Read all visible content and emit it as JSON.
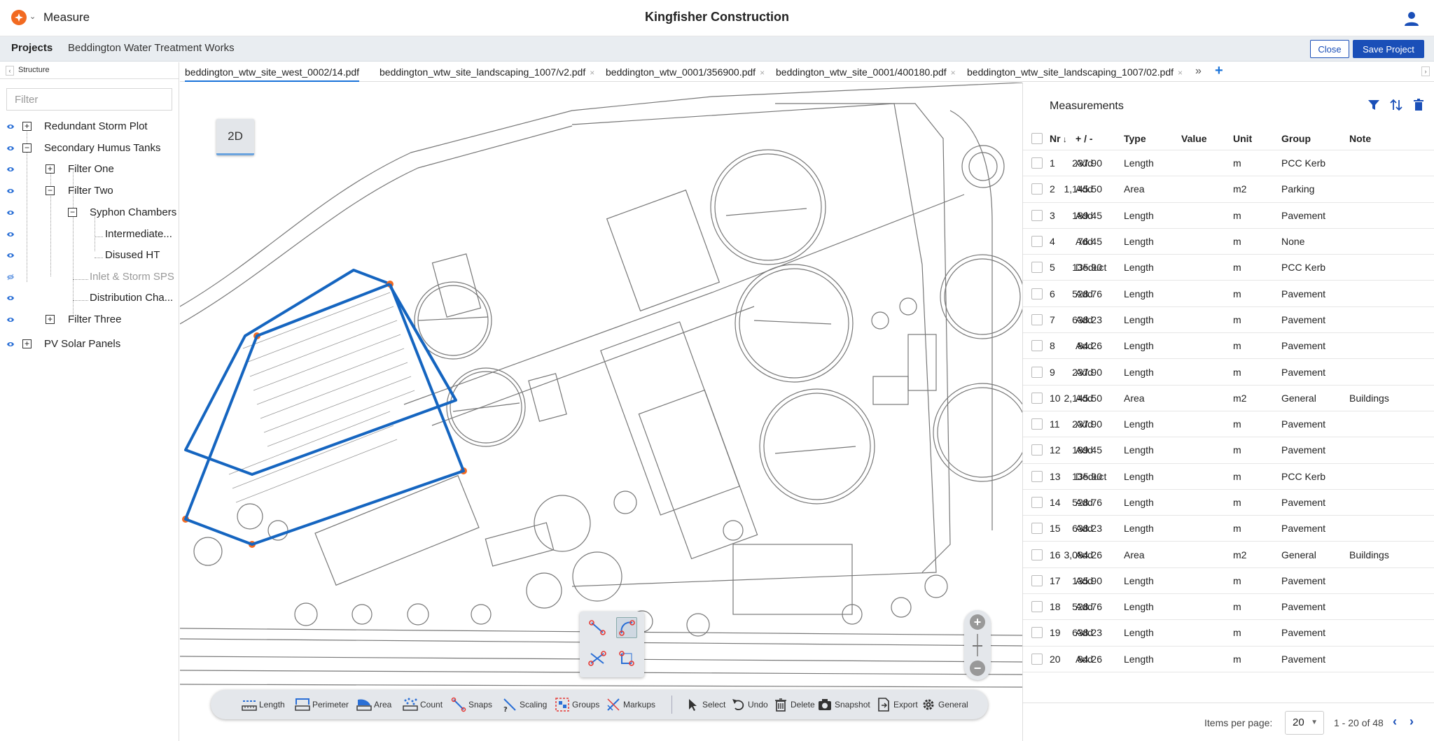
{
  "header": {
    "app_name": "Measure",
    "company": "Kingfisher Construction"
  },
  "projectbar": {
    "label": "Projects",
    "project_name": "Beddington Water Treatment Works",
    "close_label": "Close",
    "save_label": "Save Project"
  },
  "structure": {
    "title": "Structure",
    "filter_placeholder": "Filter",
    "items": [
      {
        "label": "Redundant Storm Plot",
        "level": 0,
        "toggle": "+"
      },
      {
        "label": "Secondary Humus Tanks",
        "level": 0,
        "toggle": "-"
      },
      {
        "label": "Filter One",
        "level": 1,
        "toggle": "+"
      },
      {
        "label": "Filter Two",
        "level": 1,
        "toggle": "-"
      },
      {
        "label": "Syphon Chambers",
        "level": 2,
        "toggle": "-"
      },
      {
        "label": "Intermediate...",
        "level": 3,
        "toggle": ""
      },
      {
        "label": "Disused HT",
        "level": 3,
        "toggle": ""
      },
      {
        "label": "Inlet & Storm SPS",
        "level": 2,
        "toggle": "",
        "hidden": true
      },
      {
        "label": "Distribution Cha...",
        "level": 2,
        "toggle": ""
      },
      {
        "label": "Filter Three",
        "level": 1,
        "toggle": "+"
      },
      {
        "label": "PV Solar Panels",
        "level": 0,
        "toggle": "+"
      }
    ]
  },
  "tabs": [
    {
      "label": "beddington_wtw_site_west_0002/14.pdf",
      "active": true
    },
    {
      "label": "beddington_wtw_site_landscaping_1007/v2.pdf"
    },
    {
      "label": "beddington_wtw_0001/356900.pdf"
    },
    {
      "label": "beddington_wtw_site_0001/400180.pdf"
    },
    {
      "label": "beddington_wtw_site_landscaping_1007/02.pdf"
    }
  ],
  "tabs_more": "»",
  "tabs_add": "+",
  "tabs_close": "×",
  "canvas": {
    "mode_label": "2D"
  },
  "toolbar": {
    "tools": [
      "Length",
      "Perimeter",
      "Area",
      "Count",
      "Snaps",
      "Scaling",
      "Groups",
      "Markups"
    ],
    "actions": [
      "Select",
      "Undo",
      "Delete",
      "Snapshot",
      "Export",
      "General"
    ]
  },
  "measurements": {
    "title": "Measurements",
    "headers": {
      "nr": "Nr",
      "op": "+ / -",
      "type": "Type",
      "value": "Value",
      "unit": "Unit",
      "group": "Group",
      "note": "Note"
    },
    "rows": [
      {
        "nr": "1",
        "op": "Add",
        "type": "Length",
        "value": "237.90",
        "unit": "m",
        "group": "PCC Kerb",
        "note": ""
      },
      {
        "nr": "2",
        "op": "Add",
        "type": "Area",
        "value": "1,145.50",
        "unit": "m2",
        "group": "Parking",
        "note": ""
      },
      {
        "nr": "3",
        "op": "Add",
        "type": "Length",
        "value": "189.45",
        "unit": "m",
        "group": "Pavement",
        "note": ""
      },
      {
        "nr": "4",
        "op": "Add",
        "type": "Length",
        "value": "76.45",
        "unit": "m",
        "group": "None",
        "note": ""
      },
      {
        "nr": "5",
        "op": "Deduct",
        "type": "Length",
        "value": "135.90",
        "unit": "m",
        "group": "PCC Kerb",
        "note": ""
      },
      {
        "nr": "6",
        "op": "Add",
        "type": "Length",
        "value": "528.76",
        "unit": "m",
        "group": "Pavement",
        "note": ""
      },
      {
        "nr": "7",
        "op": "Add",
        "type": "Length",
        "value": "638.23",
        "unit": "m",
        "group": "Pavement",
        "note": ""
      },
      {
        "nr": "8",
        "op": "Add",
        "type": "Length",
        "value": "84.26",
        "unit": "m",
        "group": "Pavement",
        "note": ""
      },
      {
        "nr": "9",
        "op": "Add",
        "type": "Length",
        "value": "237.90",
        "unit": "m",
        "group": "Pavement",
        "note": ""
      },
      {
        "nr": "10",
        "op": "Add",
        "type": "Area",
        "value": "2,145.50",
        "unit": "m2",
        "group": "General",
        "note": "Buildings"
      },
      {
        "nr": "11",
        "op": "Add",
        "type": "Length",
        "value": "237.90",
        "unit": "m",
        "group": "Pavement",
        "note": ""
      },
      {
        "nr": "12",
        "op": "Add",
        "type": "Length",
        "value": "189.45",
        "unit": "m",
        "group": "Pavement",
        "note": ""
      },
      {
        "nr": "13",
        "op": "Deduct",
        "type": "Length",
        "value": "135.90",
        "unit": "m",
        "group": "PCC Kerb",
        "note": ""
      },
      {
        "nr": "14",
        "op": "Add",
        "type": "Length",
        "value": "528.76",
        "unit": "m",
        "group": "Pavement",
        "note": ""
      },
      {
        "nr": "15",
        "op": "Add",
        "type": "Length",
        "value": "638.23",
        "unit": "m",
        "group": "Pavement",
        "note": ""
      },
      {
        "nr": "16",
        "op": "Add",
        "type": "Area",
        "value": "3,084.26",
        "unit": "m2",
        "group": "General",
        "note": "Buildings"
      },
      {
        "nr": "17",
        "op": "Add",
        "type": "Length",
        "value": "135.90",
        "unit": "m",
        "group": "Pavement",
        "note": ""
      },
      {
        "nr": "18",
        "op": "Add",
        "type": "Length",
        "value": "528.76",
        "unit": "m",
        "group": "Pavement",
        "note": ""
      },
      {
        "nr": "19",
        "op": "Add",
        "type": "Length",
        "value": "638.23",
        "unit": "m",
        "group": "Pavement",
        "note": ""
      },
      {
        "nr": "20",
        "op": "Add",
        "type": "Length",
        "value": "84.26",
        "unit": "m",
        "group": "Pavement",
        "note": ""
      }
    ],
    "items_per_page_label": "Items per page:",
    "items_per_page": "20",
    "range": "1 - 20 of 48"
  },
  "colors": {
    "accent": "#1a4fb8",
    "measure_line": "#1565c0",
    "vertex": "#f26a21",
    "brand": "#f26a21"
  },
  "icons": {
    "brand": "brand-logo-icon",
    "user": "user-icon",
    "eye": "eye-icon",
    "filter": "filter-icon",
    "sort": "sort-icon",
    "delete": "trash-icon"
  }
}
